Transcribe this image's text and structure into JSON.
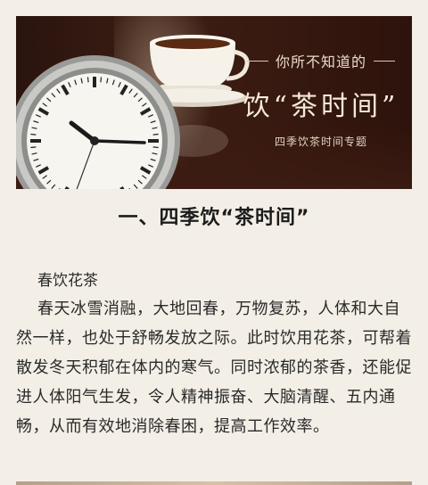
{
  "banner": {
    "subtitle": "你所不知道的",
    "title": "饮“茶时间”",
    "tagline": "四季饮茶时间专题"
  },
  "section": {
    "title": "一、四季饮“茶时间”"
  },
  "article": {
    "subheading": "春饮花茶",
    "paragraph": "春天冰雪消融，大地回春，万物复苏，人体和大自然一样，也处于舒畅发放之际。此时饮用花茶，可帮着散发冬天积郁在体内的寒气。同时浓郁的茶香，还能促进人体阳气生发，令人精神振奋、大脑清醒、五内通畅，从而有效地消除春困，提高工作效率。"
  },
  "colors": {
    "background": "#f3efe6",
    "banner_dark": "#2a140e",
    "text": "#2a2a2a"
  },
  "icons": [
    "clock-illustration",
    "teacup-illustration"
  ]
}
